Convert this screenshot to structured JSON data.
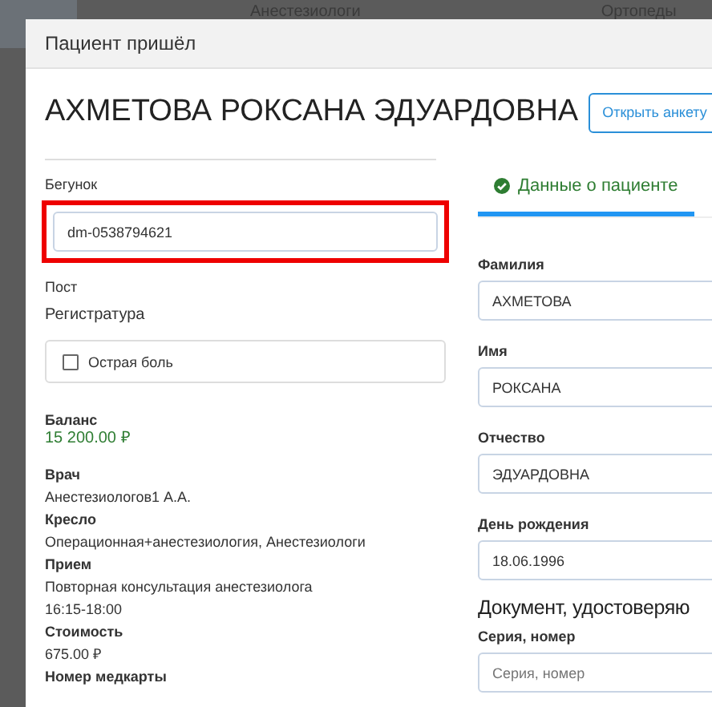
{
  "background": {
    "columns": [
      "Анестезиологи",
      "Ортопеды"
    ]
  },
  "modal": {
    "title": "Пациент пришёл",
    "patient_name": "АХМЕТОВА РОКСАНА ЭДУАРДОВНА",
    "open_button": "Открыть анкету",
    "runner": {
      "label": "Бегунок",
      "value": "dm-0538794621",
      "highlighted": true
    },
    "post": {
      "label": "Пост",
      "value": "Регистратура"
    },
    "acute_pain": {
      "label": "Острая боль",
      "checked": false
    },
    "balance": {
      "label": "Баланс",
      "value": "15 200.00 ₽"
    },
    "details": [
      {
        "label": "Врач",
        "values": [
          "Анестезиологов1 А.А."
        ]
      },
      {
        "label": "Кресло",
        "values": [
          "Операционная+анестезиология, Анестезиологи"
        ]
      },
      {
        "label": "Прием",
        "values": [
          "Повторная консультация анестезиолога",
          "16:15-18:00"
        ]
      },
      {
        "label": "Стоимость",
        "values": [
          "675.00 ₽"
        ]
      },
      {
        "label": "Номер медкарты"
      }
    ],
    "tabs": [
      {
        "label": "Данные о пациенте",
        "selected": true
      }
    ],
    "fields": [
      {
        "label": "Фамилия",
        "value": "АХМЕТОВА"
      },
      {
        "label": "Имя",
        "value": "РОКСАНА"
      },
      {
        "label": "Отчество",
        "value": "ЭДУАРДОВНА"
      },
      {
        "label": "День рождения",
        "value": "18.06.1996"
      }
    ],
    "document": {
      "heading": "Документ, удостоверяю",
      "fields": [
        {
          "label": "Серия, номер",
          "placeholder": "Серия, номер"
        }
      ]
    }
  }
}
